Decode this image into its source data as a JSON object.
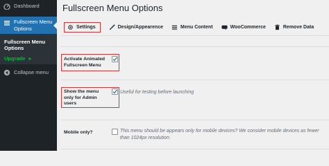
{
  "sidebar": {
    "dashboard_label": "Dashboard",
    "active_item_label": "Fullscreen Menu Options",
    "submenu": {
      "title": "Fullscreen Menu Options",
      "upgrade_label": "Upgrade",
      "upgrade_arrow": "➤"
    },
    "collapse_label": "Collapse menu"
  },
  "page": {
    "title": "Fullscreen Menu Options"
  },
  "tabs": [
    {
      "label": "Settings",
      "icon": "gear-icon",
      "active": true
    },
    {
      "label": "Design/Appearence",
      "icon": "brush-icon"
    },
    {
      "label": "Menu Content",
      "icon": "menu-icon"
    },
    {
      "label": "WooCommerce",
      "icon": "woocommerce-icon"
    },
    {
      "label": "Remove Data",
      "icon": "trash-icon"
    }
  ],
  "settings": {
    "animated": {
      "label": "Activate Animated Fullscreen Menu",
      "checked": true
    },
    "admin_only": {
      "label": "Show the menu only for Admin users",
      "checked": true,
      "description": "Useful for testing before launching"
    },
    "mobile_only": {
      "label": "Mobile only?",
      "checked": false,
      "description": "This menu should be appears only for mobile devices? We consider mobile devices as fewer than 1024px resolution."
    }
  },
  "colors": {
    "sidebar_bg": "#1d2327",
    "active_bg": "#2271b1",
    "highlight_border": "#d63638",
    "upgrade_green": "#00ba37",
    "checkmark_blue": "#2271b1"
  }
}
